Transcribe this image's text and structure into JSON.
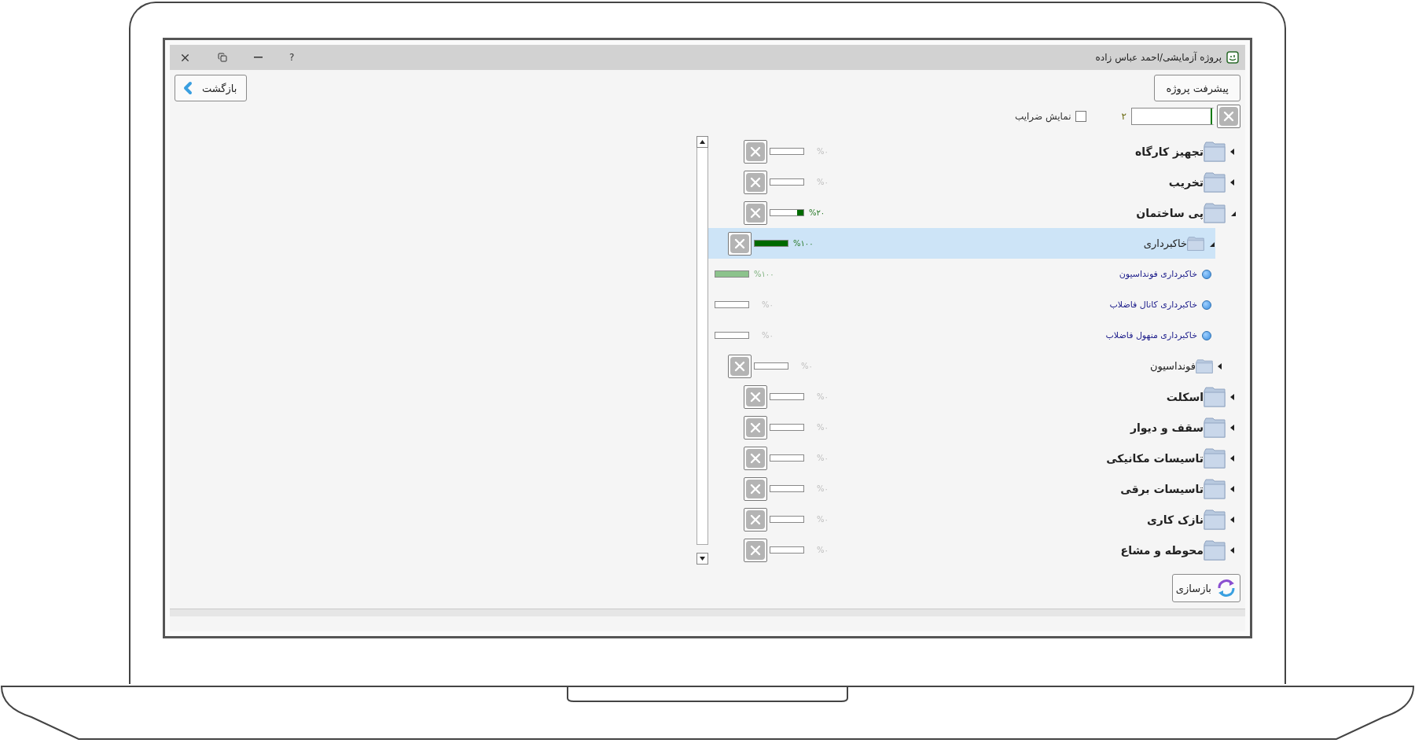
{
  "window": {
    "title": "پروژه آزمایشی/احمد عباس زاده",
    "help": "?"
  },
  "header": {
    "progress_button": "پیشرفت پروژه",
    "back_button": "بازگشت"
  },
  "toolbar": {
    "count": "۲",
    "show_coefficients": {
      "label": "نمایش ضرایب",
      "checked": false
    }
  },
  "tree": [
    {
      "label": "تجهیز کارگاه",
      "kind": "folder",
      "expanded": false,
      "selected": false,
      "level": 0,
      "reading": "%۰"
    },
    {
      "label": "تخریب",
      "kind": "folder",
      "expanded": false,
      "selected": false,
      "level": 0,
      "reading": "%۰"
    },
    {
      "label": "پی ساختمان",
      "kind": "folder",
      "expanded": true,
      "selected": false,
      "level": 0.2,
      "reading": "%۲۰",
      "children": [
        {
          "label": "خاکبرداری",
          "kind": "folder",
          "expanded": true,
          "selected": true,
          "level": 1,
          "reading": "%۱۰۰",
          "children": [
            {
              "label": "خاکبرداری فونداسیون",
              "kind": "task",
              "selected": false,
              "level": 1,
              "reading": "%۱۰۰"
            },
            {
              "label": "خاکبرداری کانال فاضلاب",
              "kind": "task",
              "selected": false,
              "level": 0,
              "reading": "%۰"
            },
            {
              "label": "خاکبرداری منهول فاضلاب",
              "kind": "task",
              "selected": false,
              "level": 0,
              "reading": "%۰"
            }
          ]
        },
        {
          "label": "فونداسیون",
          "kind": "folder",
          "expanded": false,
          "selected": false,
          "level": 0,
          "reading": "%۰"
        }
      ]
    },
    {
      "label": "اسکلت",
      "kind": "folder",
      "expanded": false,
      "selected": false,
      "level": 0,
      "reading": "%۰"
    },
    {
      "label": "سقف و دیوار",
      "kind": "folder",
      "expanded": false,
      "selected": false,
      "level": 0,
      "reading": "%۰"
    },
    {
      "label": "تاسیسات مکانیکی",
      "kind": "folder",
      "expanded": false,
      "selected": false,
      "level": 0,
      "reading": "%۰"
    },
    {
      "label": "تاسیسات برقی",
      "kind": "folder",
      "expanded": false,
      "selected": false,
      "level": 0,
      "reading": "%۰"
    },
    {
      "label": "نازک کاری",
      "kind": "folder",
      "expanded": false,
      "selected": false,
      "level": 0,
      "reading": "%۰"
    },
    {
      "label": "محوطه و مشاع",
      "kind": "folder",
      "expanded": false,
      "selected": false,
      "level": 0,
      "reading": "%۰"
    }
  ],
  "rebuild_button": "بازسازی"
}
